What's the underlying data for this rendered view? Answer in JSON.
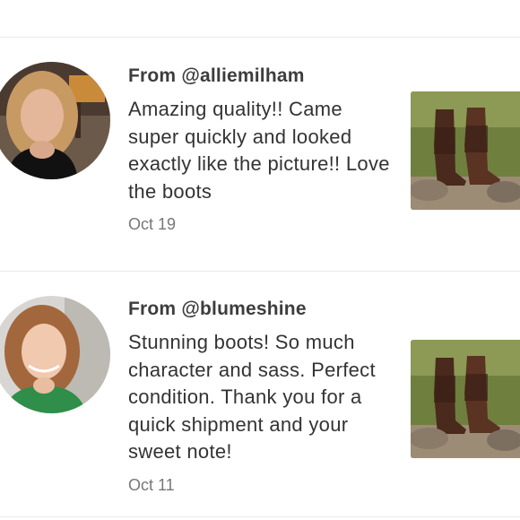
{
  "reviews": [
    {
      "author": "From @alliemilham",
      "text": "Amazing quality!! Came super quickly and looked exactly like the picture!! Love the boots",
      "date": "Oct 19",
      "avatar_icon": "reviewer-avatar",
      "thumb_icon": "boots-photo"
    },
    {
      "author": "From @blumeshine",
      "text": "Stunning boots! So much character and sass. Perfect condition. Thank you for a quick shipment and your sweet note!",
      "date": "Oct 11",
      "avatar_icon": "reviewer-avatar",
      "thumb_icon": "boots-photo"
    }
  ],
  "colors": {
    "author": "#3d3d3d",
    "text": "#333333",
    "date": "#777777",
    "divider": "#e9e9e9"
  }
}
